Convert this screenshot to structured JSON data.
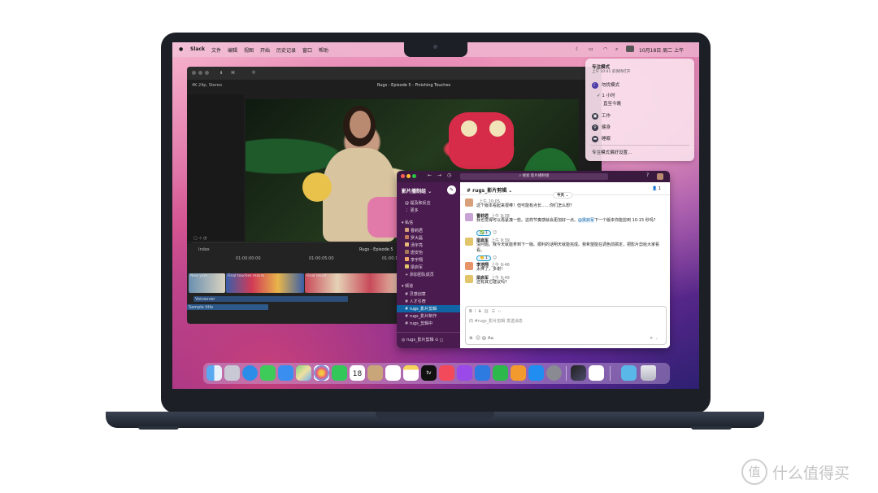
{
  "menubar": {
    "app": "Slack",
    "items": [
      "文件",
      "编辑",
      "视图",
      "开始",
      "历史记录",
      "窗口",
      "帮助"
    ],
    "clock": "10月18日 周二 上午"
  },
  "editor": {
    "format": "4K 24p, Stereo",
    "title": "Rugs - Episode 5 - Finishing Touches",
    "index_label": "Index",
    "project_label": "Rugs - Episode 5",
    "timecode_1": "01:00:00:00",
    "timecode_2": "01:00:05:00",
    "timecode_3": "01:00:10:00",
    "clip_1": "New yarn",
    "clip_2": "Final touches macro",
    "clip_3": "Final result",
    "voiceover": "Voiceover",
    "sample": "Sample title"
  },
  "focus_menu": {
    "title": "专注模式",
    "subtitle": "上午 10:41 前保持打开",
    "dnd": "勿扰模式",
    "one_hour": "1 小时",
    "until_tonight": "直至今晚",
    "work": "工作",
    "fitness": "健身",
    "sleep": "睡眠",
    "settings": "专注模式偏好设置..."
  },
  "slack": {
    "search_placeholder": "搜索 影片播制组",
    "workspace": "影片播制组",
    "sidebar": {
      "mentions": "提及和反应",
      "more": "更多",
      "dm_header": "私信",
      "dms": [
        "曹莉君",
        "罗大磊",
        "汤宇亮",
        "唐安怡",
        "李宇翔",
        "梁启军"
      ],
      "add_members": "添加团队成员",
      "channels_header": "频道",
      "channels": [
        "灵感创意",
        "人才引荐",
        "rugs_影片剪辑",
        "rugs_影片制作",
        "rugs_剪辑中"
      ],
      "bottom": "rugs_影片剪辑"
    },
    "channel": {
      "name": "# rugs_影片剪辑",
      "members": "1",
      "today": "今天"
    },
    "messages": [
      {
        "name": "",
        "time": "上午 10:05",
        "text": "这个版本看起来很棒！但可能有点长……你们怎么想？"
      },
      {
        "name": "曹莉君",
        "time": "上午 9:38",
        "text": "我也觉得可以再紧凑一些。这样节奏感就会更加好一点。",
        "mention": "@梁启军",
        "text2": "下一个版本你能剪到 10-15 秒吗？"
      },
      {
        "name": "梁启军",
        "time": "上午 9:39",
        "text": "没问题。我今天就能拿到下一版。顺利的话明天就能完成。我希望能在调色前搞定，把影片剪给大家看看。"
      },
      {
        "name": "李浩翔",
        "time": "上午 9:46",
        "text": "太棒了，多谢！"
      },
      {
        "name": "梁启军",
        "time": "上午 9:49",
        "text": "还有其它建议吗？"
      }
    ],
    "reactions": [
      "1",
      "1",
      "1"
    ],
    "composer_placeholder": "向 #rugs_影片剪辑 发送消息",
    "composer_toolbar": [
      "B",
      "I",
      "S"
    ]
  },
  "dock": {
    "calendar_day": "18",
    "icons": [
      "finder-icon",
      "launchpad-icon",
      "safari-icon",
      "messages-icon",
      "mail-icon",
      "maps-icon",
      "photos-icon",
      "facetime-icon",
      "calendar-icon",
      "contacts-icon",
      "reminders-icon",
      "notes-icon",
      "tv-icon",
      "music-icon",
      "podcasts-icon",
      "keynote-icon",
      "numbers-icon",
      "pages-icon",
      "app-store-icon",
      "system-settings-icon",
      "final-cut-icon",
      "slack-icon",
      "folder-icon",
      "trash-icon"
    ],
    "tv_label": "tv"
  },
  "watermark": {
    "text": "什么值得买",
    "glyph": "值"
  }
}
